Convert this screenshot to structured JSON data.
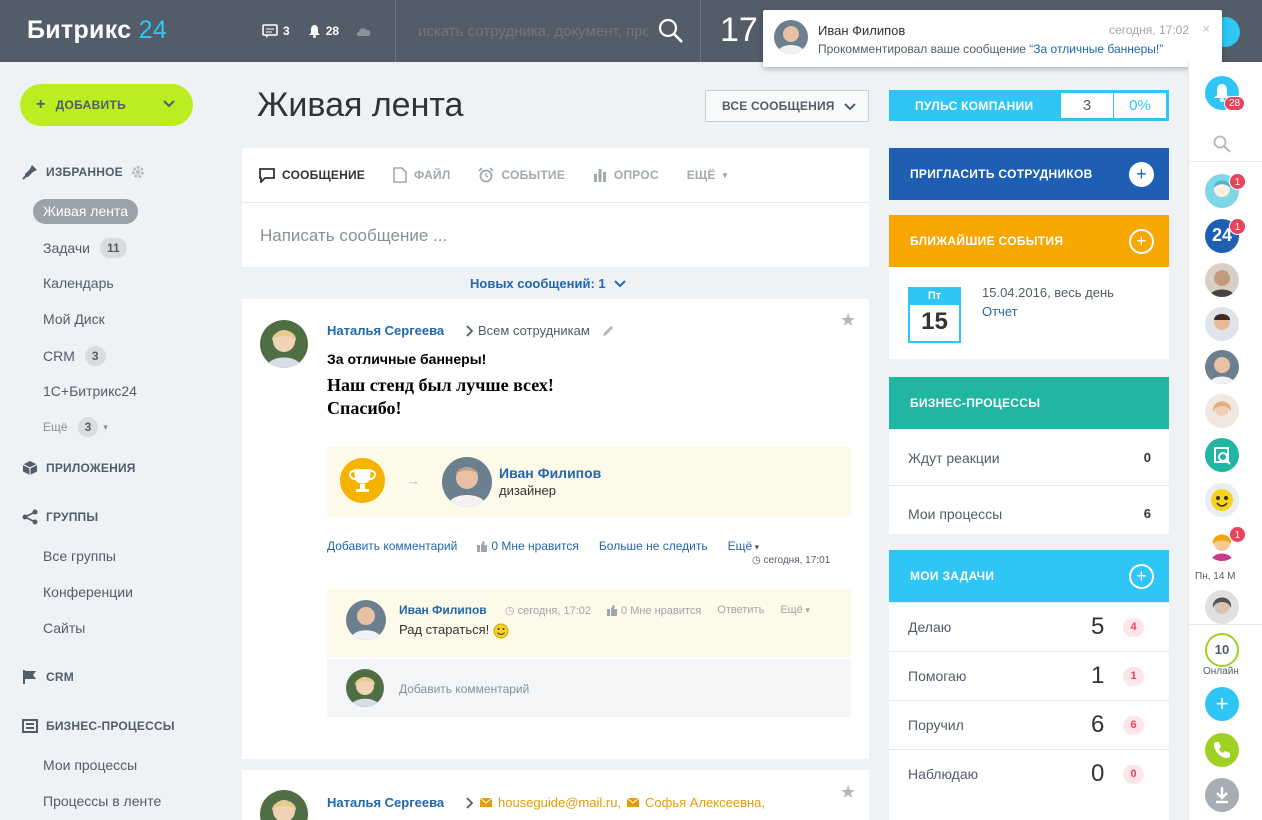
{
  "header": {
    "logo_text": "Битрикс",
    "logo_num": "24",
    "messages_count": "3",
    "notifications_count": "28",
    "search_placeholder": "искать сотрудника, документ, прочее...",
    "clock": "17"
  },
  "notification": {
    "name": "Иван Филипов",
    "time": "сегодня, 17:02",
    "close": "×",
    "text": "Прокомментировал ваше сообщение",
    "link_text": "“За отличные баннеры!”"
  },
  "sidebar": {
    "add_label": "ДОБАВИТЬ",
    "favorites": "ИЗБРАННОЕ",
    "items": [
      {
        "label": "Живая лента"
      },
      {
        "label": "Задачи",
        "count": "11"
      },
      {
        "label": "Календарь"
      },
      {
        "label": "Мой Диск"
      },
      {
        "label": "CRM",
        "count": "3"
      },
      {
        "label": "1С+Битрикс24"
      },
      {
        "label": "Ещё",
        "count": "3"
      }
    ],
    "apps": "ПРИЛОЖЕНИЯ",
    "groups": "ГРУППЫ",
    "group_items": [
      "Все группы",
      "Конференции",
      "Сайты"
    ],
    "crm": "CRM",
    "bp": "БИЗНЕС-ПРОЦЕССЫ",
    "bp_items": [
      "Мои процессы",
      "Процессы в ленте"
    ]
  },
  "main": {
    "title": "Живая лента",
    "filter_label": "ВСЕ СООБЩЕНИЯ",
    "composer_tabs": [
      "СООБЩЕНИЕ",
      "ФАЙЛ",
      "СОБЫТИЕ",
      "ОПРОС",
      "ЕЩЁ"
    ],
    "composer_placeholder": "Написать сообщение ...",
    "new_messages": "Новых сообщений: 1"
  },
  "post1": {
    "author": "Наталья Сергеева",
    "destination": "Всем сотрудникам",
    "title": "За отличные баннеры!",
    "body_line1": "Наш стенд был лучше всех!",
    "body_line2": "Спасибо!",
    "grat_name": "Иван Филипов",
    "grat_position": "дизайнер",
    "action_comment": "Добавить комментарий",
    "likes": "0 Мне нравится",
    "action_unfollow": "Больше не следить",
    "action_more": "Ещё",
    "time": "сегодня, 17:01",
    "comment": {
      "author": "Иван Филипов",
      "time": "сегодня, 17:02",
      "likes": "0 Мне нравится",
      "reply": "Ответить",
      "more": "Ещё",
      "text": "Рад стараться!"
    },
    "add_comment_placeholder": "Добавить комментарий"
  },
  "post2": {
    "author": "Наталья Сергеева",
    "dest1": "houseguide@mail.ru,",
    "dest2": "Софья Алексеевна,"
  },
  "right": {
    "pulse_label": "ПУЛЬС КОМПАНИИ",
    "pulse_count": "3",
    "pulse_percent": "0%",
    "invite_label": "ПРИГЛАСИТЬ СОТРУДНИКОВ",
    "events_label": "БЛИЖАЙШИЕ СОБЫТИЯ",
    "event_day": "Пт",
    "event_num": "15",
    "event_date": "15.04.2016, весь день",
    "event_title": "Отчет",
    "bp_label": "БИЗНЕС-ПРОЦЕССЫ",
    "bp_rows": [
      {
        "label": "Ждут реакции",
        "value": "0"
      },
      {
        "label": "Мои процессы",
        "value": "6"
      }
    ],
    "tasks_label": "МОИ ЗАДАЧИ",
    "task_rows": [
      {
        "label": "Делаю",
        "value": "5",
        "badge": "4"
      },
      {
        "label": "Помогаю",
        "value": "1",
        "badge": "1"
      },
      {
        "label": "Поручил",
        "value": "6",
        "badge": "6"
      },
      {
        "label": "Наблюдаю",
        "value": "0",
        "badge": "0"
      }
    ]
  },
  "rbar": {
    "bell_badge": "28",
    "badges": [
      "1",
      "1",
      "1"
    ],
    "date_label": "Пн, 14 М",
    "online_count": "10",
    "online_label": "Онлайн"
  },
  "colors": {
    "header_bg": "#535c69",
    "accent_blue": "#2fc6f6",
    "link": "#2067b0",
    "add_button": "#bbed21",
    "invite_bg": "#1e5fb3",
    "events_bg": "#f7a700",
    "bp_bg": "#20b6a2",
    "badge_red": "#e9425c"
  }
}
